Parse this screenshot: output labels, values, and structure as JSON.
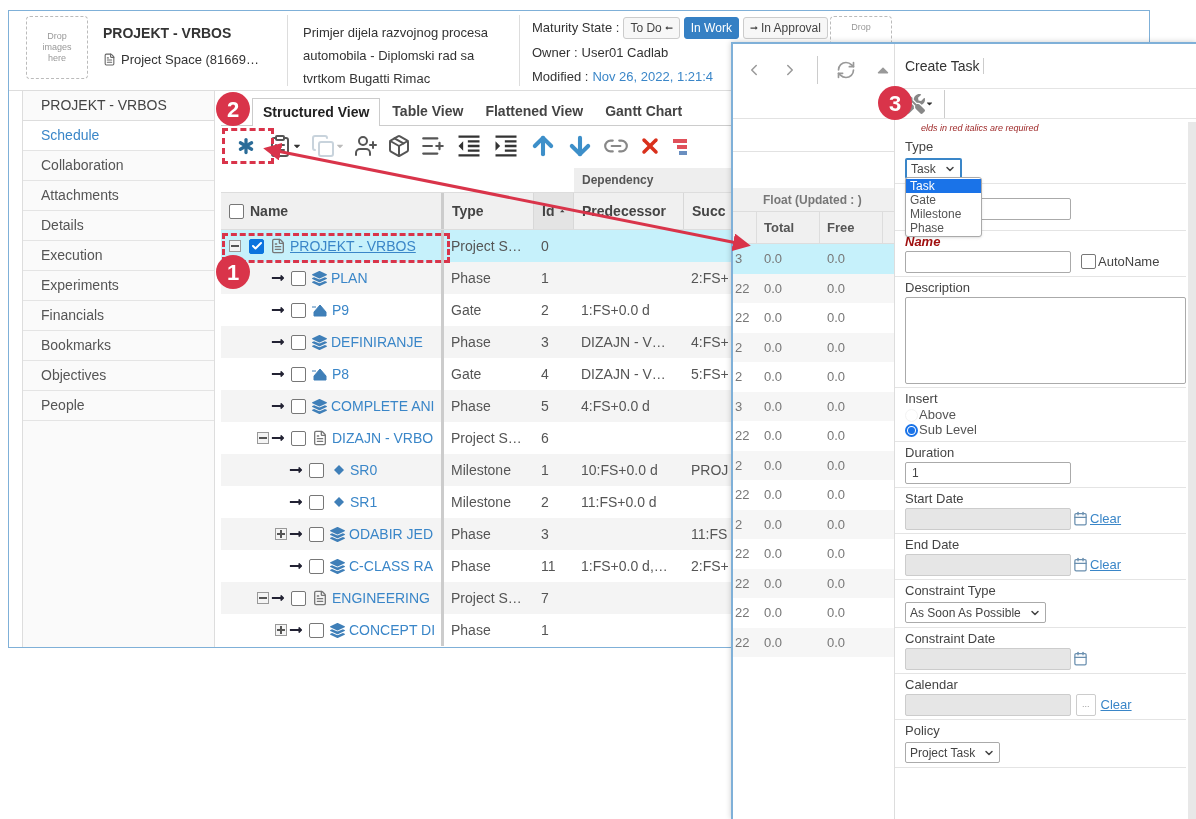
{
  "header": {
    "drop_zone": "Drop images here",
    "title": "PROJEKT - VRBOS",
    "subtitle": "Project Space (81669…",
    "description": "Primjer dijela razvojnog procesa automobila - Diplomski rad sa tvrtkom Bugatti Rimac",
    "maturity_label": "Maturity State :",
    "states": [
      {
        "label": "To Do",
        "kind": "previous",
        "selected": false
      },
      {
        "label": "In Work",
        "kind": "current",
        "selected": true
      },
      {
        "label": "In Approval",
        "kind": "next",
        "selected": false
      }
    ],
    "owner_label": "Owner :",
    "owner": "User01 Cadlab",
    "modified_label": "Modified :",
    "modified": "Nov 26, 2022, 1:21:4",
    "drop_zone_2": "Drop"
  },
  "sidebar": {
    "heading": "PROJEKT - VRBOS",
    "items": [
      {
        "label": "Schedule",
        "selected": true
      },
      {
        "label": "Collaboration",
        "selected": false
      },
      {
        "label": "Attachments",
        "selected": false
      },
      {
        "label": "Details",
        "selected": false
      },
      {
        "label": "Execution",
        "selected": false
      },
      {
        "label": "Experiments",
        "selected": false
      },
      {
        "label": "Financials",
        "selected": false
      },
      {
        "label": "Bookmarks",
        "selected": false
      },
      {
        "label": "Objectives",
        "selected": false
      },
      {
        "label": "People",
        "selected": false
      }
    ]
  },
  "tabs": [
    {
      "label": "Structured View",
      "selected": true
    },
    {
      "label": "Table View",
      "selected": false
    },
    {
      "label": "Flattened View",
      "selected": false
    },
    {
      "label": "Gantt Chart",
      "selected": false
    }
  ],
  "table": {
    "group_header": "Dependency",
    "all_checked": false,
    "columns": [
      {
        "label": "Name",
        "sorted": false
      },
      {
        "label": "Type",
        "sorted": false
      },
      {
        "label": "Id",
        "sorted": true
      },
      {
        "label": "Predecessor",
        "sorted": false
      },
      {
        "label": "Succ",
        "sorted": false
      }
    ],
    "rows": [
      {
        "name": "PROJEKT - VRBOS",
        "kind": "project",
        "type": "Project S…",
        "id": "0",
        "checked": true,
        "selected": true,
        "expanded": true,
        "children": [
          {
            "name": "PLAN",
            "kind": "phase",
            "type": "Phase",
            "id": "1",
            "succ": "2:FS+",
            "checked": false,
            "selected": false
          },
          {
            "name": "P9",
            "kind": "gate",
            "type": "Gate",
            "id": "2",
            "predecessor": "1:FS+0.0 d",
            "checked": false,
            "selected": false
          },
          {
            "name": "DEFINIRANJE",
            "kind": "phase",
            "type": "Phase",
            "id": "3",
            "predecessor": "DIZAJN - V…",
            "succ": "4:FS+",
            "checked": false,
            "selected": false
          },
          {
            "name": "P8",
            "kind": "gate",
            "type": "Gate",
            "id": "4",
            "predecessor": "DIZAJN - V…",
            "succ": "5:FS+",
            "checked": false,
            "selected": false
          },
          {
            "name": "COMPLETE ANI",
            "kind": "phase",
            "type": "Phase",
            "id": "5",
            "predecessor": "4:FS+0.0 d",
            "checked": false,
            "selected": false
          },
          {
            "name": "DIZAJN - VRBO",
            "kind": "project",
            "type": "Project S…",
            "id": "6",
            "checked": false,
            "selected": false,
            "expanded": true,
            "children": [
              {
                "name": "SR0",
                "kind": "milestone",
                "type": "Milestone",
                "id": "1",
                "predecessor": "10:FS+0.0 d",
                "succ": "PROJ",
                "checked": false,
                "selected": false
              },
              {
                "name": "SR1",
                "kind": "milestone",
                "type": "Milestone",
                "id": "2",
                "predecessor": "11:FS+0.0 d",
                "checked": false,
                "selected": false
              },
              {
                "name": "ODABIR JED",
                "kind": "phase",
                "type": "Phase",
                "id": "3",
                "succ": "11:FS",
                "checked": false,
                "selected": false,
                "expanded": false
              },
              {
                "name": "C-CLASS RA",
                "kind": "phase",
                "type": "Phase",
                "id": "11",
                "predecessor": "1:FS+0.0 d,…",
                "succ": "2:FS+",
                "checked": false,
                "selected": false
              }
            ]
          },
          {
            "name": "ENGINEERING",
            "kind": "project",
            "type": "Project S…",
            "id": "7",
            "checked": false,
            "selected": false,
            "expanded": true,
            "children": [
              {
                "name": "CONCEPT DI",
                "kind": "phase",
                "type": "Phase",
                "id": "1",
                "checked": false,
                "selected": false,
                "expanded": false
              }
            ]
          }
        ]
      }
    ]
  },
  "float_table": {
    "group_header": "Float (Updated : )",
    "columns": [
      "Total",
      "Free"
    ],
    "rows": [
      {
        "column_1": "3",
        "total": "0.0",
        "free": "0.0",
        "selected": true
      },
      {
        "column_1": "22",
        "total": "0.0",
        "free": "0.0",
        "selected": false
      },
      {
        "column_1": "22",
        "total": "0.0",
        "free": "0.0",
        "selected": false
      },
      {
        "column_1": "2",
        "total": "0.0",
        "free": "0.0",
        "selected": false
      },
      {
        "column_1": "2",
        "total": "0.0",
        "free": "0.0",
        "selected": false
      },
      {
        "column_1": "3",
        "total": "0.0",
        "free": "0.0",
        "selected": false
      },
      {
        "column_1": "22",
        "total": "0.0",
        "free": "0.0",
        "selected": false
      },
      {
        "column_1": "2",
        "total": "0.0",
        "free": "0.0",
        "selected": false
      },
      {
        "column_1": "22",
        "total": "0.0",
        "free": "0.0",
        "selected": false
      },
      {
        "column_1": "2",
        "total": "0.0",
        "free": "0.0",
        "selected": false
      },
      {
        "column_1": "22",
        "total": "0.0",
        "free": "0.0",
        "selected": false
      },
      {
        "column_1": "22",
        "total": "0.0",
        "free": "0.0",
        "selected": false
      },
      {
        "column_1": "22",
        "total": "0.0",
        "free": "0.0",
        "selected": false
      },
      {
        "column_1": "22",
        "total": "0.0",
        "free": "0.0",
        "selected": false
      }
    ]
  },
  "create_task": {
    "title": "Create Task",
    "required_note": "elds in red italics are required",
    "fields": [
      {
        "kind": "select",
        "label": "Type",
        "value": "Task",
        "required": false,
        "disabled": false,
        "open": true,
        "options": [
          {
            "label": "Task",
            "selected": true
          },
          {
            "label": "Gate",
            "selected": false
          },
          {
            "label": "Milestone",
            "selected": false
          },
          {
            "label": "Phase",
            "selected": false
          }
        ]
      },
      {
        "kind": "text",
        "disabled": false
      },
      {
        "kind": "text",
        "label": "Name",
        "required": true,
        "disabled": false,
        "checkbox": {
          "label": "AutoName",
          "checked": false
        }
      },
      {
        "kind": "textarea",
        "label": "Description",
        "required": false,
        "disabled": false
      },
      {
        "kind": "radio",
        "label": "Insert",
        "required": false,
        "options": [
          {
            "label": "Above",
            "selected": false
          },
          {
            "label": "Sub Level",
            "selected": true
          }
        ]
      },
      {
        "kind": "text",
        "label": "Duration",
        "value": "1",
        "required": false,
        "disabled": false
      },
      {
        "kind": "date",
        "label": "Start Date",
        "link": "Clear",
        "required": false,
        "disabled": true
      },
      {
        "kind": "date",
        "label": "End Date",
        "link": "Clear",
        "required": false,
        "disabled": true
      },
      {
        "kind": "select",
        "label": "Constraint Type",
        "value": "As Soon As Possible",
        "required": false,
        "disabled": false,
        "open": false
      },
      {
        "kind": "date",
        "label": "Constraint Date",
        "required": false,
        "disabled": true
      },
      {
        "kind": "chooser",
        "label": "Calendar",
        "button": "...",
        "link": "Clear",
        "required": false,
        "disabled": true
      },
      {
        "kind": "select",
        "label": "Policy",
        "value": "Project Task",
        "required": false,
        "disabled": false,
        "open": false
      }
    ]
  },
  "annotations": [
    {
      "label": "1"
    },
    {
      "label": "2"
    },
    {
      "label": "3"
    }
  ]
}
